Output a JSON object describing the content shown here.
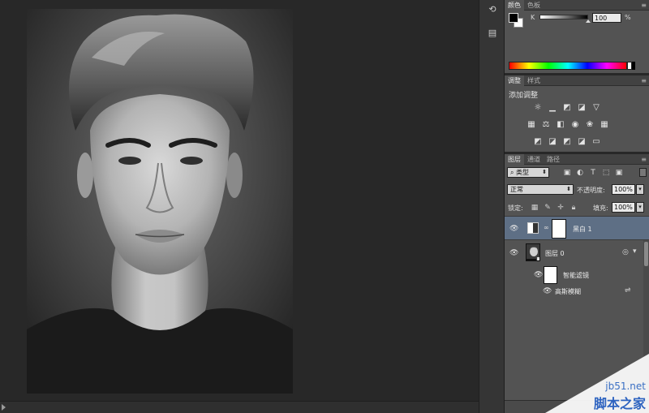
{
  "color_panel": {
    "tabs": [
      "颜色",
      "色板"
    ],
    "channel_label": "K",
    "channel_value": "100",
    "unit": "%",
    "foreground": "#000000",
    "background": "#ffffff"
  },
  "adjustments_panel": {
    "tabs": [
      "调整",
      "样式"
    ],
    "title": "添加调整",
    "icons": [
      "brightness-icon",
      "levels-icon",
      "curves-icon",
      "exposure-icon",
      "vibrance-icon",
      "hue-saturation-icon",
      "color-balance-icon",
      "black-white-icon",
      "photo-filter-icon",
      "channel-mixer-icon",
      "color-lookup-icon",
      "invert-icon",
      "posterize-icon",
      "threshold-icon",
      "selective-color-icon",
      "gradient-map-icon"
    ]
  },
  "layers_panel": {
    "tabs": [
      "图层",
      "通道",
      "路径"
    ],
    "filter_kind": "类型",
    "blend_mode": "正常",
    "opacity_label": "不透明度:",
    "opacity_value": "100%",
    "lock_label": "锁定:",
    "fill_label": "填充:",
    "fill_value": "100%",
    "layers": [
      {
        "name": "黑白 1",
        "type": "adjustment",
        "selected": true,
        "visible": true
      },
      {
        "name": "图层 0",
        "type": "smart-object",
        "selected": false,
        "visible": true
      }
    ],
    "smart_filters_label": "智能滤镜",
    "filter_effect": "高斯模糊"
  },
  "watermark": {
    "site": "jb51.net",
    "name": "脚本之家"
  }
}
